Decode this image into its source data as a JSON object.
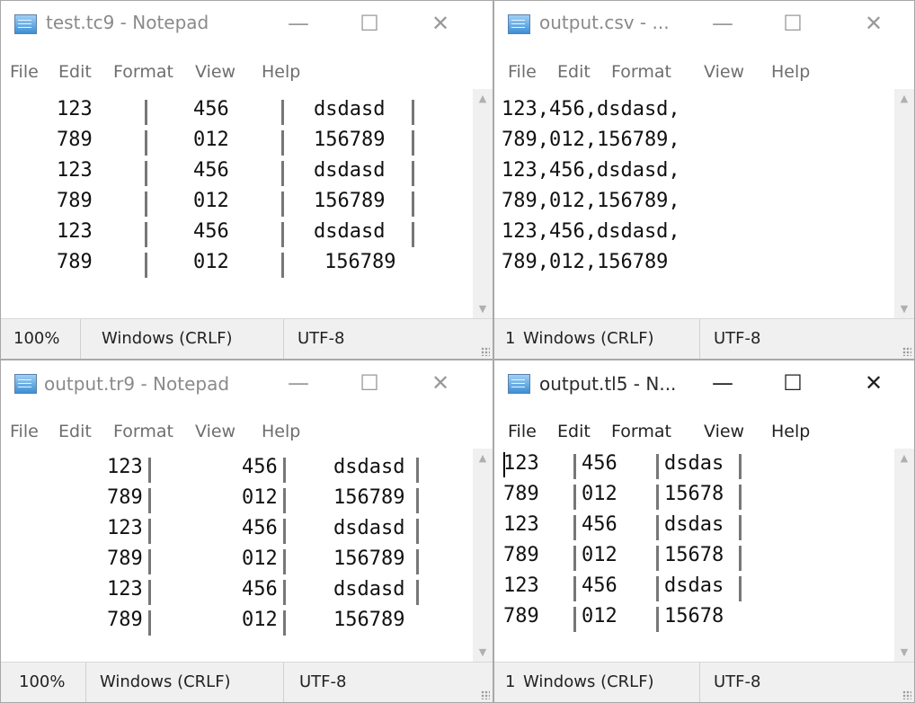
{
  "windows": {
    "tc9": {
      "title": "test.tc9 - Notepad",
      "menu": [
        "File",
        "Edit",
        "Format",
        "View",
        "Help"
      ],
      "lines": [
        [
          "123",
          "456",
          "dsdasd"
        ],
        [
          "789",
          "012",
          "156789"
        ],
        [
          "123",
          "456",
          "dsdasd"
        ],
        [
          "789",
          "012",
          "156789"
        ],
        [
          "123",
          "456",
          "dsdasd"
        ],
        [
          "789",
          "012",
          "156789"
        ]
      ],
      "status": {
        "zoom": "100%",
        "eol": "Windows (CRLF)",
        "encoding": "UTF-8"
      }
    },
    "csv": {
      "title": "output.csv - ...",
      "menu": [
        "File",
        "Edit",
        "Format",
        "View",
        "Help"
      ],
      "lines": [
        "123,456,dsdasd,",
        "789,012,156789,",
        "123,456,dsdasd,",
        "789,012,156789,",
        "123,456,dsdasd,",
        "789,012,156789"
      ],
      "status": {
        "zoom": "1",
        "eol": "Windows (CRLF)",
        "encoding": "UTF-8"
      }
    },
    "tr9": {
      "title": "output.tr9 - Notepad",
      "menu": [
        "File",
        "Edit",
        "Format",
        "View",
        "Help"
      ],
      "lines": [
        [
          "123",
          "456",
          "dsdasd"
        ],
        [
          "789",
          "012",
          "156789"
        ],
        [
          "123",
          "456",
          "dsdasd"
        ],
        [
          "789",
          "012",
          "156789"
        ],
        [
          "123",
          "456",
          "dsdasd"
        ],
        [
          "789",
          "012",
          "156789"
        ]
      ],
      "status": {
        "zoom": "100%",
        "eol": "Windows (CRLF)",
        "encoding": "UTF-8"
      }
    },
    "tl5": {
      "title": "output.tl5 - N...",
      "menu": [
        "File",
        "Edit",
        "Format",
        "View",
        "Help"
      ],
      "lines": [
        [
          "123",
          "456",
          "dsdas"
        ],
        [
          "789",
          "012",
          "15678"
        ],
        [
          "123",
          "456",
          "dsdas"
        ],
        [
          "789",
          "012",
          "15678"
        ],
        [
          "123",
          "456",
          "dsdas"
        ],
        [
          "789",
          "012",
          "15678"
        ]
      ],
      "status": {
        "zoom": "1",
        "eol": "Windows (CRLF)",
        "encoding": "UTF-8"
      }
    }
  },
  "icons": {
    "minimize": "—",
    "maximize": "☐",
    "close": "✕",
    "scroll_up": "▲",
    "scroll_down": "▼"
  },
  "colors": {
    "title_inactive": "#8a8a8a",
    "title_active": "#2b2b2b",
    "status_bg": "#f0f0f0"
  }
}
